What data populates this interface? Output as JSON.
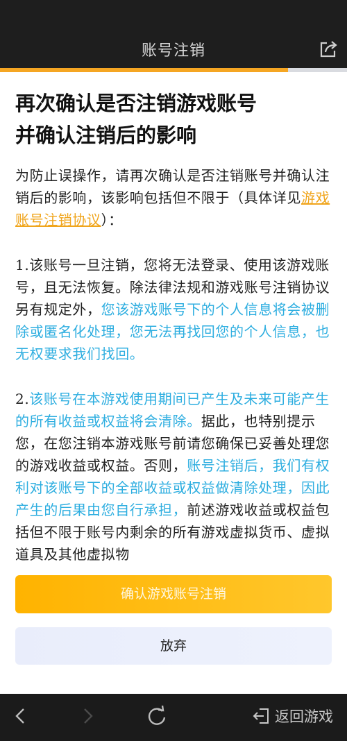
{
  "header": {
    "title": "账号注销",
    "share_icon": "share-icon",
    "progress_percent": 83
  },
  "heading": {
    "line1": "再次确认是否注销游戏账号",
    "line2": "并确认注销后的影响"
  },
  "intro": {
    "text_before_link": "为防止误操作，请再次确认是否注销账号并确认注销后的影响，该影响包括但不限于（具体详见",
    "link_text": "游戏账号注销协议",
    "text_after_link": "）："
  },
  "item1": {
    "number": "1.",
    "text_plain": "该账号一旦注销，您将无法登录、使用该游戏账号，且无法恢复。除法律法规和游戏账号注销协议另有规定外，",
    "text_highlight": "您该游戏账号下的个人信息将会被删除或匿名化处理，您无法再找回您的个人信息，也无权要求我们找回。"
  },
  "item2": {
    "number": "2.",
    "text_highlight1": "该账号在本游戏使用期间已产生及未来可能产生的所有收益或权益将会清除。",
    "text_plain1": "据此，也特别提示您，在您注销本游戏账号前请您确保已妥善处理您的游戏收益或权益。否则，",
    "text_highlight2": "账号注销后，我们有权利对该账号下的全部收益或权益做清除处理，因此产生的后果由您自行承担，",
    "text_plain2": "前述游戏收益或权益包括但不限于账号内剩余的所有游戏虚拟货币、虚拟道具及其他虚拟物"
  },
  "buttons": {
    "confirm_label": "确认游戏账号注销",
    "cancel_label": "放弃"
  },
  "bottom_nav": {
    "back_icon": "chevron-left-icon",
    "forward_icon": "chevron-right-icon",
    "refresh_icon": "refresh-icon",
    "return_label": "返回游戏"
  },
  "colors": {
    "accent_orange": "#f5a623",
    "highlight_blue": "#2eaee0",
    "dark_bar": "#1e1e1e"
  }
}
